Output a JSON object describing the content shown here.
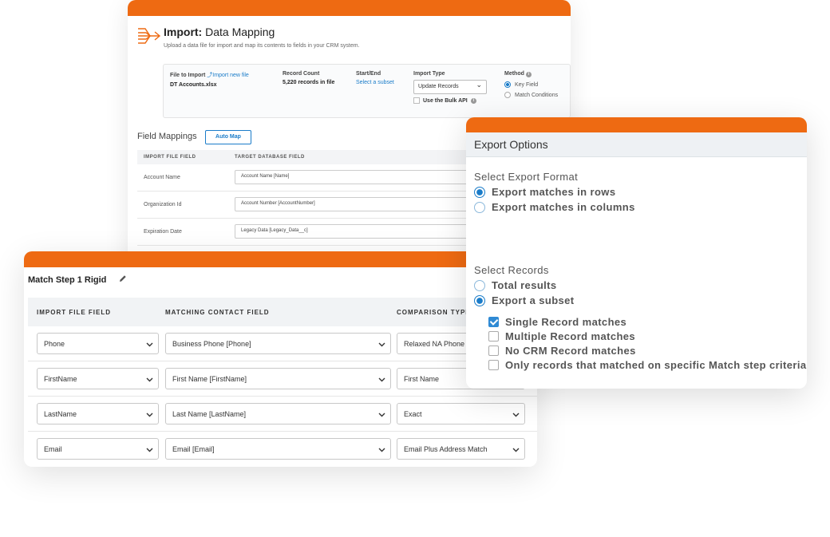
{
  "import_card": {
    "title_bold": "Import:",
    "title_rest": " Data Mapping",
    "subtitle": "Upload a data file for import and map its contents to fields in your CRM system.",
    "file_label": "File to Import",
    "import_new_file": "Import new file",
    "file_name": "DT Accounts.xlsx",
    "record_count_label": "Record Count",
    "record_count_value": "5,220 records in file",
    "start_end_label": "Start/End",
    "select_subset": "Select a subset",
    "import_type_label": "Import Type",
    "import_type_value": "Update Records",
    "bulk_api_label": "Use the Bulk API",
    "method_label": "Method",
    "method_options": [
      "Key Field",
      "Match Conditions"
    ],
    "field_mappings_title": "Field Mappings",
    "auto_map": "Auto Map",
    "col_import_file_field": "IMPORT FILE FIELD",
    "col_target_db_field": "TARGET DATABASE FIELD",
    "rows": [
      {
        "label": "Account Name",
        "target": "Account Name [Name]"
      },
      {
        "label": "Organization Id",
        "target": "Account Number [AccountNumber]"
      },
      {
        "label": "Expiration Date",
        "target": "Legacy Data [Legacy_Data__c]"
      }
    ]
  },
  "match_card": {
    "title": "Match Step 1 Rigid",
    "col_import_file_field": "IMPORT FILE FIELD",
    "col_matching_contact_field": "MATCHING CONTACT FIELD",
    "col_comparison_type": "COMPARISON TYPE",
    "rows": [
      {
        "file_field": "Phone",
        "contact_field": "Business Phone [Phone]",
        "comparison": "Relaxed NA Phone"
      },
      {
        "file_field": "FirstName",
        "contact_field": "First Name [FirstName]",
        "comparison": "First Name"
      },
      {
        "file_field": "LastName",
        "contact_field": "Last Name [LastName]",
        "comparison": "Exact"
      },
      {
        "file_field": "Email",
        "contact_field": "Email [Email]",
        "comparison": "Email Plus Address Match"
      }
    ]
  },
  "export_card": {
    "title": "Export Options",
    "format_section": "Select Export Format",
    "format_options": [
      "Export matches in rows",
      "Export matches in columns"
    ],
    "records_section": "Select Records",
    "records_options": [
      "Total results",
      "Export a subset"
    ],
    "subset_options": [
      {
        "label": "Single Record matches",
        "checked": true
      },
      {
        "label": "Multiple Record matches",
        "checked": false
      },
      {
        "label": "No CRM Record matches",
        "checked": false
      },
      {
        "label": "Only records that matched on specific Match step criteria",
        "checked": false
      }
    ]
  },
  "colors": {
    "accent_orange": "#ee6a12",
    "link_blue": "#1a7cc9"
  }
}
